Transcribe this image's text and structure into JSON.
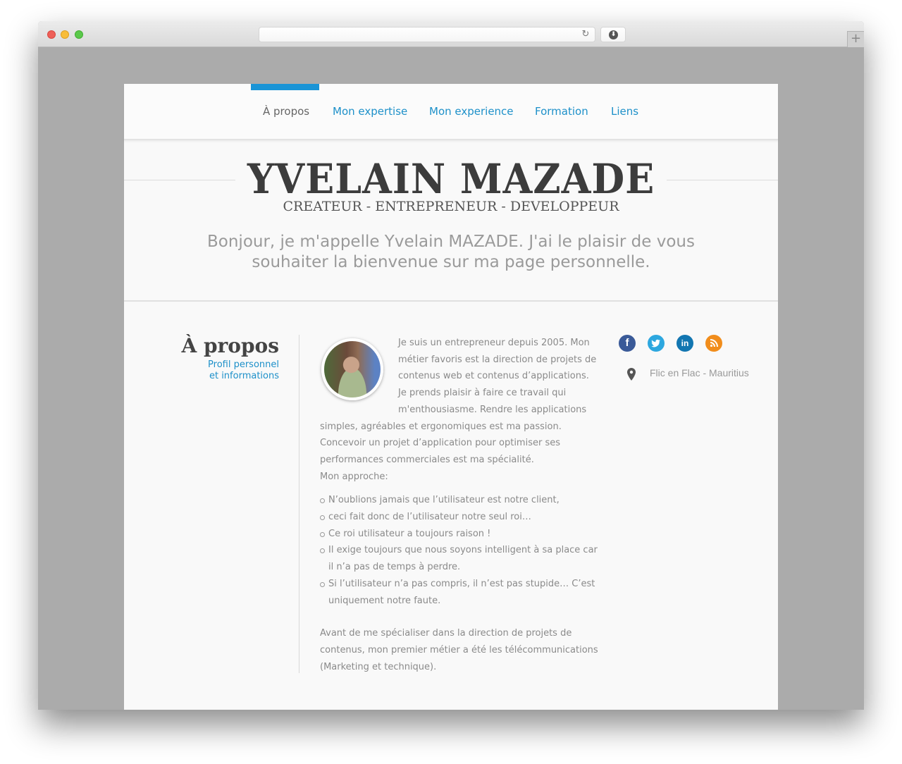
{
  "browser": {
    "url": "",
    "reload_icon": "↻",
    "download_icon": "⬇",
    "new_tab_icon": "+"
  },
  "nav": {
    "active_color": "#1a94d6",
    "items": [
      {
        "label": "À propos",
        "active": true
      },
      {
        "label": "Mon expertise",
        "active": false
      },
      {
        "label": "Mon experience",
        "active": false
      },
      {
        "label": "Formation",
        "active": false
      },
      {
        "label": "Liens",
        "active": false
      }
    ]
  },
  "header": {
    "name": "YVELAIN MAZADE",
    "subtitle": "CREATEUR - ENTREPRENEUR - DEVELOPPEUR",
    "intro": "Bonjour, je m'appelle Yvelain MAZADE. J'ai le plaisir de vous souhaiter la bienvenue sur ma page personnelle."
  },
  "about": {
    "heading": "À propos",
    "subheading_line1": "Profil personnel",
    "subheading_line2": "et informations",
    "paragraph1": "Je suis un entrepreneur depuis 2005. Mon métier favoris est la direction de projets de contenus web et contenus d’applications. Je prends plaisir à faire ce travail qui m'enthousiasme. Rendre les applications simples, agréables et ergonomiques est ma passion. Concevoir un projet d’application pour optimiser ses performances commerciales est ma spécialité.",
    "approach_label": "Mon approche:",
    "bullets": [
      "N’oublions jamais que l’utilisateur est notre client,",
      "ceci fait donc de l’utilisateur notre seul roi…",
      "Ce roi utilisateur a toujours raison !",
      "Il exige toujours que nous soyons intelligent à sa place car il n’a pas de temps à perdre.",
      "Si l’utilisateur n’a pas compris, il n’est pas stupide… C’est uniquement notre faute."
    ],
    "paragraph2": "Avant de me spécialiser dans la direction de projets de contenus, mon premier métier a été les télécommunications (Marketing et technique)."
  },
  "sidebar": {
    "social": [
      {
        "name": "facebook",
        "glyph": "f",
        "color": "#3a5a98"
      },
      {
        "name": "twitter",
        "glyph": "t",
        "color": "#2da7df"
      },
      {
        "name": "linkedin",
        "glyph": "in",
        "color": "#1276b1"
      },
      {
        "name": "rss",
        "glyph": "))",
        "color": "#f18d1c"
      }
    ],
    "location": "Flic en Flac - Mauritius"
  }
}
